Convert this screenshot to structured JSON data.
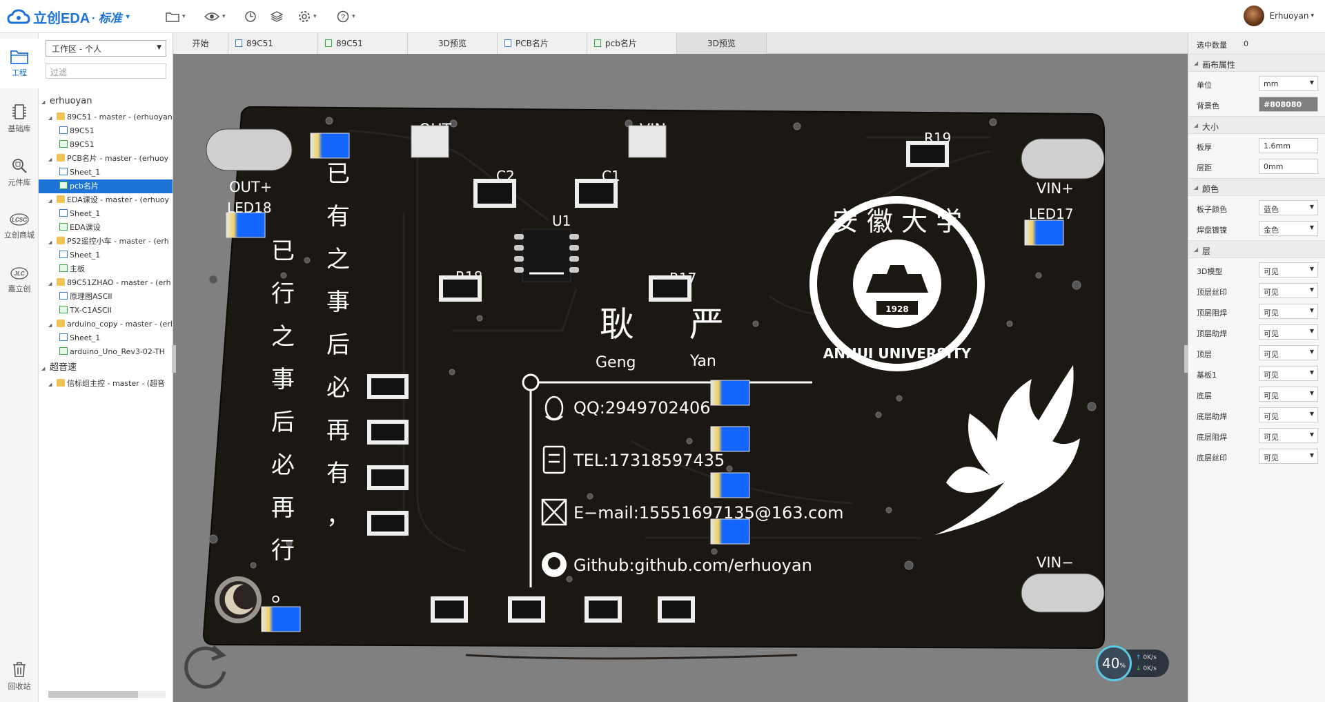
{
  "app": {
    "logo_text": "立创EDA",
    "logo_sub": "· 标准",
    "user_name": "Erhuoyan"
  },
  "toolbar": {
    "icons": [
      "folder-icon",
      "eye-icon",
      "history-icon",
      "layers-icon",
      "gear-icon",
      "help-icon"
    ]
  },
  "leftnav": [
    {
      "label": "工程",
      "icon": "project-icon",
      "active": true
    },
    {
      "label": "基础库",
      "icon": "chip-icon"
    },
    {
      "label": "元件库",
      "icon": "search-icon"
    },
    {
      "label": "立创商城",
      "icon": "lcsc-icon"
    },
    {
      "label": "嘉立创",
      "icon": "jlc-icon"
    },
    {
      "label": "回收站",
      "icon": "trash-icon"
    }
  ],
  "tree": {
    "workspace": "工作区 - 个人",
    "filter_placeholder": "过滤",
    "items": [
      {
        "label": "erhuoyan",
        "type": "root"
      },
      {
        "label": "89C51 - master - (erhuoyan",
        "type": "folder"
      },
      {
        "label": "89C51",
        "type": "sch"
      },
      {
        "label": "89C51",
        "type": "pcb"
      },
      {
        "label": "PCB名片 - master - (erhuoy",
        "type": "folder"
      },
      {
        "label": "Sheet_1",
        "type": "sch"
      },
      {
        "label": "pcb名片",
        "type": "pcb",
        "selected": true
      },
      {
        "label": "EDA课设 - master - (erhuoy",
        "type": "folder"
      },
      {
        "label": "Sheet_1",
        "type": "sch"
      },
      {
        "label": "EDA课设",
        "type": "pcb"
      },
      {
        "label": "PS2遥控小车 - master - (erh",
        "type": "folder"
      },
      {
        "label": "Sheet_1",
        "type": "sch"
      },
      {
        "label": "主板",
        "type": "pcb"
      },
      {
        "label": "89C51ZHAO - master - (erh",
        "type": "folder"
      },
      {
        "label": "原理图ASCII",
        "type": "sch"
      },
      {
        "label": "TX-C1ASCII",
        "type": "pcb"
      },
      {
        "label": "arduino_copy - master - (erl",
        "type": "folder"
      },
      {
        "label": "Sheet_1",
        "type": "sch"
      },
      {
        "label": "arduino_Uno_Rev3-02-TH",
        "type": "pcb"
      },
      {
        "label": "超音速",
        "type": "root"
      },
      {
        "label": "信标组主控 - master - (超音",
        "type": "folder"
      }
    ]
  },
  "tabs": [
    {
      "label": "开始",
      "icon": ""
    },
    {
      "label": "89C51",
      "icon": "sch"
    },
    {
      "label": "89C51",
      "icon": "pcb"
    },
    {
      "label": "3D预览",
      "icon": ""
    },
    {
      "label": "PCB名片",
      "icon": "sch"
    },
    {
      "label": "pcb名片",
      "icon": "pcb"
    },
    {
      "label": "3D预览",
      "icon": "",
      "active": true
    }
  ],
  "right": {
    "selected_label": "选中数量",
    "selected_count": "0",
    "canvas_header": "画布属性",
    "unit_label": "单位",
    "unit_value": "mm",
    "bg_label": "背景色",
    "bg_value": "#808080",
    "size_header": "大小",
    "thickness_label": "板厚",
    "thickness_value": "1.6mm",
    "spacing_label": "层距",
    "spacing_value": "0mm",
    "color_header": "颜色",
    "board_color_label": "板子颜色",
    "board_color_value": "蓝色",
    "pad_plating_label": "焊盘镀镍",
    "pad_plating_value": "金色",
    "layers_header": "层",
    "layers": [
      {
        "label": "3D模型",
        "value": "可见"
      },
      {
        "label": "顶层丝印",
        "value": "可见"
      },
      {
        "label": "顶层阻焊",
        "value": "可见"
      },
      {
        "label": "顶层助焊",
        "value": "可见"
      },
      {
        "label": "顶层",
        "value": "可见"
      },
      {
        "label": "基板1",
        "value": "可见"
      },
      {
        "label": "底层",
        "value": "可见"
      },
      {
        "label": "底层助焊",
        "value": "可见"
      },
      {
        "label": "底层阻焊",
        "value": "可见"
      },
      {
        "label": "底层丝印",
        "value": "可见"
      }
    ]
  },
  "pcb": {
    "labels": {
      "out": "OUT",
      "vin": "VIN",
      "out_plus": "OUT+",
      "vin_plus": "VIN+",
      "vin_minus": "VIN−",
      "led18": "LED18",
      "led17": "LED17",
      "c2": "C2",
      "c1": "C1",
      "u1": "U1",
      "r18": "R18",
      "r17": "R17",
      "r19": "R19"
    },
    "name_cn_1": "耿",
    "name_cn_2": "严",
    "name_py_1": "Geng",
    "name_py_2": "Yan",
    "qq": "QQ:2949702406",
    "tel": "TEL:17318597435",
    "email": "E−mail:15551697135@163.com",
    "github": "Github:github.com/erhuoyan",
    "poem_left": [
      "已",
      "行",
      "之",
      "事",
      "后",
      "必",
      "再",
      "行",
      "。"
    ],
    "poem_right": [
      "已",
      "有",
      "之",
      "事",
      "后",
      "必",
      "再",
      "有",
      "，"
    ],
    "university": "ANHUI UNIVERSITY",
    "year": "1928",
    "seal_chars": "安 徽 大 学"
  },
  "status": {
    "cpu": "40",
    "cpu_unit": "%",
    "up": "0K/s",
    "down": "0K/s"
  }
}
